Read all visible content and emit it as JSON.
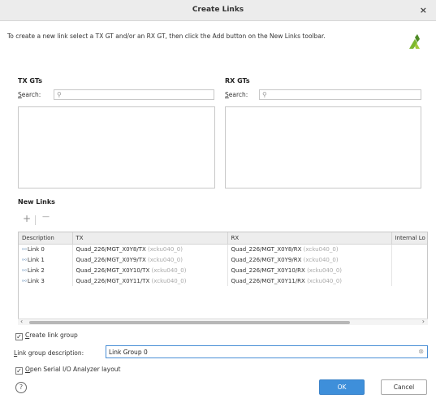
{
  "window": {
    "title": "Create Links",
    "close_label": "×"
  },
  "instruction": "To create a new link select a TX GT and/or an RX GT, then click the Add button on the New Links toolbar.",
  "tx": {
    "heading": "TX GTs",
    "search_label_hot": "S",
    "search_label_rest": "earch:",
    "search_value": ""
  },
  "rx": {
    "heading": "RX GTs",
    "search_label_hot": "S",
    "search_label_rest": "earch:",
    "search_value": ""
  },
  "new_links": {
    "heading": "New Links",
    "add_label": "+",
    "remove_label": "—",
    "columns": [
      "Description",
      "TX",
      "RX",
      "Internal Lo"
    ],
    "rows": [
      {
        "desc": "Link 0",
        "tx": "Quad_226/MGT_X0Y8/TX",
        "tx_dev": "(xcku040_0)",
        "rx": "Quad_226/MGT_X0Y8/RX",
        "rx_dev": "(xcku040_0)"
      },
      {
        "desc": "Link 1",
        "tx": "Quad_226/MGT_X0Y9/TX",
        "tx_dev": "(xcku040_0)",
        "rx": "Quad_226/MGT_X0Y9/RX",
        "rx_dev": "(xcku040_0)"
      },
      {
        "desc": "Link 2",
        "tx": "Quad_226/MGT_X0Y10/TX",
        "tx_dev": "(xcku040_0)",
        "rx": "Quad_226/MGT_X0Y10/RX",
        "rx_dev": "(xcku040_0)"
      },
      {
        "desc": "Link 3",
        "tx": "Quad_226/MGT_X0Y11/TX",
        "tx_dev": "(xcku040_0)",
        "rx": "Quad_226/MGT_X0Y11/RX",
        "rx_dev": "(xcku040_0)"
      }
    ]
  },
  "options": {
    "create_group_hot": "C",
    "create_group_rest": "reate link group",
    "create_group_checked": true,
    "desc_label_hot": "L",
    "desc_label_rest": "ink group description:",
    "desc_value": "Link Group 0",
    "open_layout_hot": "O",
    "open_layout_rest": "pen Serial I/O Analyzer layout",
    "open_layout_checked": true
  },
  "buttons": {
    "help": "?",
    "ok": "OK",
    "cancel": "Cancel"
  },
  "colors": {
    "accent": "#3e8fda",
    "logo": "#7cb82f"
  }
}
